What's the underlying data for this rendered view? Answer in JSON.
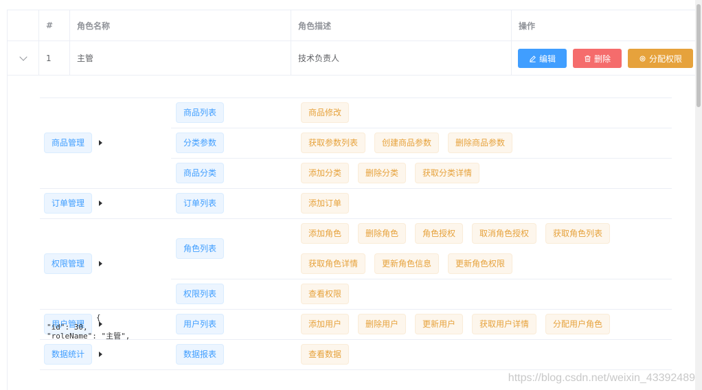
{
  "table": {
    "headers": [
      "",
      "#",
      "角色名称",
      "角色描述",
      "操作"
    ],
    "row": {
      "index": "1",
      "name": "主管",
      "desc": "技术负责人"
    },
    "buttons": {
      "edit": "编辑",
      "delete": "删除",
      "assign": "分配权限"
    }
  },
  "rights": {
    "groups": [
      {
        "label": "商品管理",
        "children": [
          {
            "label": "商品列表",
            "items": [
              "商品修改"
            ]
          },
          {
            "label": "分类参数",
            "items": [
              "获取参数列表",
              "创建商品参数",
              "删除商品参数"
            ]
          },
          {
            "label": "商品分类",
            "items": [
              "添加分类",
              "删除分类",
              "获取分类详情"
            ]
          }
        ]
      },
      {
        "label": "订单管理",
        "children": [
          {
            "label": "订单列表",
            "items": [
              "添加订单"
            ]
          }
        ]
      },
      {
        "label": "权限管理",
        "children": [
          {
            "label": "角色列表",
            "items": [
              "添加角色",
              "删除角色",
              "角色授权",
              "取消角色授权",
              "获取角色列表",
              "获取角色详情",
              "更新角色信息",
              "更新角色权限"
            ]
          },
          {
            "label": "权限列表",
            "items": [
              "查看权限"
            ]
          }
        ]
      },
      {
        "label": "用户管理",
        "children": [
          {
            "label": "用户列表",
            "items": [
              "添加用户",
              "删除用户",
              "更新用户",
              "获取用户详情",
              "分配用户角色"
            ]
          }
        ]
      },
      {
        "label": "数据统计",
        "children": [
          {
            "label": "数据报表",
            "items": [
              "查看数据"
            ]
          }
        ]
      }
    ]
  },
  "json_dump": {
    "line1": "{",
    "line2": "\"id\": 30,",
    "line3": "\"roleName\": \"主管\","
  },
  "watermark": "https://blog.csdn.net/weixin_43392489",
  "colors": {
    "primary": "#409eff",
    "danger": "#f56c6c",
    "warning": "#e6a23c"
  }
}
